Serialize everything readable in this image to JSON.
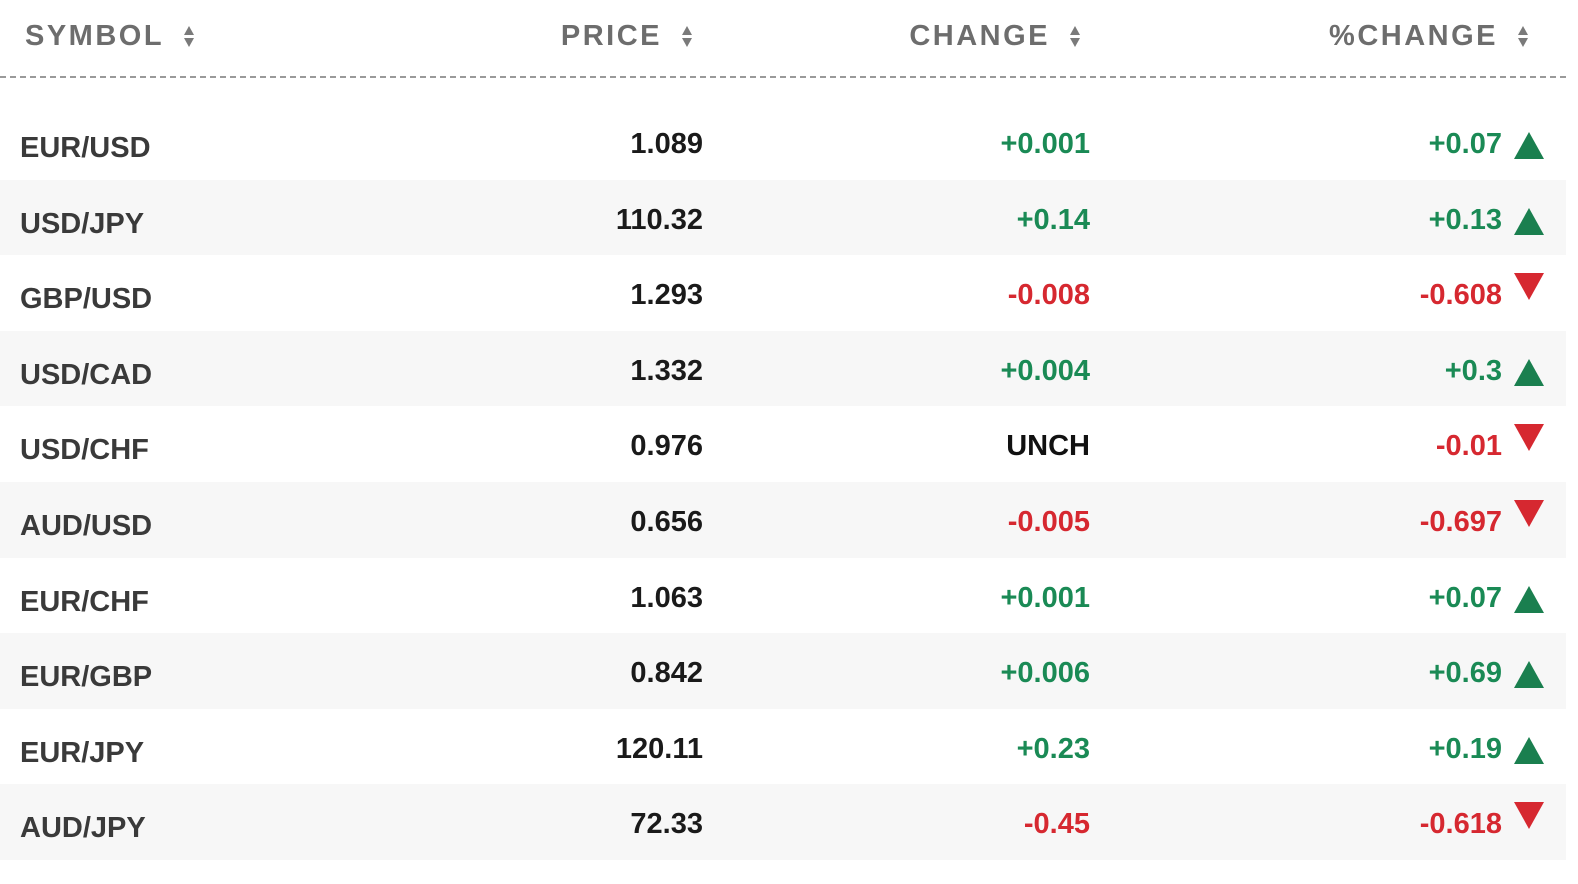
{
  "colors": {
    "positive": "#1a8a55",
    "negative": "#d62830",
    "neutral": "#111111",
    "header_text": "#6d6d6d",
    "row_alt_bg": "#f7f7f7"
  },
  "header": {
    "symbol": "SYMBOL",
    "price": "PRICE",
    "change": "CHANGE",
    "pct_change": "%CHANGE"
  },
  "rows": [
    {
      "symbol": "EUR/USD",
      "price": "1.089",
      "change": "+0.001",
      "pct": "+0.07",
      "dir": "up"
    },
    {
      "symbol": "USD/JPY",
      "price": "110.32",
      "change": "+0.14",
      "pct": "+0.13",
      "dir": "up"
    },
    {
      "symbol": "GBP/USD",
      "price": "1.293",
      "change": "-0.008",
      "pct": "-0.608",
      "dir": "down"
    },
    {
      "symbol": "USD/CAD",
      "price": "1.332",
      "change": "+0.004",
      "pct": "+0.3",
      "dir": "up"
    },
    {
      "symbol": "USD/CHF",
      "price": "0.976",
      "change": "UNCH",
      "pct": "-0.01",
      "dir": "down"
    },
    {
      "symbol": "AUD/USD",
      "price": "0.656",
      "change": "-0.005",
      "pct": "-0.697",
      "dir": "down"
    },
    {
      "symbol": "EUR/CHF",
      "price": "1.063",
      "change": "+0.001",
      "pct": "+0.07",
      "dir": "up"
    },
    {
      "symbol": "EUR/GBP",
      "price": "0.842",
      "change": "+0.006",
      "pct": "+0.69",
      "dir": "up"
    },
    {
      "symbol": "EUR/JPY",
      "price": "120.11",
      "change": "+0.23",
      "pct": "+0.19",
      "dir": "up"
    },
    {
      "symbol": "AUD/JPY",
      "price": "72.33",
      "change": "-0.45",
      "pct": "-0.618",
      "dir": "down"
    }
  ]
}
